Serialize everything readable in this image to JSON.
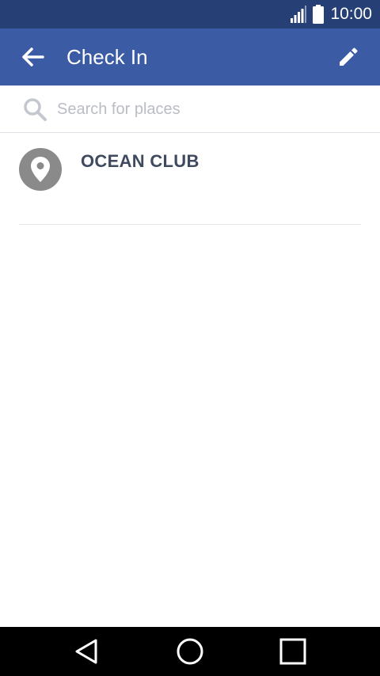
{
  "status_bar": {
    "time": "10:00",
    "icons": [
      "signal-icon",
      "battery-icon"
    ]
  },
  "app_bar": {
    "title": "Check In",
    "back_icon": "arrow-left-icon",
    "action_icon": "pencil-icon"
  },
  "search": {
    "placeholder": "Search for places",
    "value": "",
    "icon": "search-icon"
  },
  "places": [
    {
      "name": "OCEAN CLUB",
      "icon": "map-pin-icon"
    }
  ],
  "nav_bar": {
    "icons": [
      "back-triangle-icon",
      "home-circle-icon",
      "recents-square-icon"
    ]
  },
  "colors": {
    "status_bar": "#263f75",
    "app_bar": "#3b5ba5",
    "place_name": "#3f4a5e",
    "avatar": "#8a8a8a",
    "placeholder": "#b9bdc4"
  }
}
